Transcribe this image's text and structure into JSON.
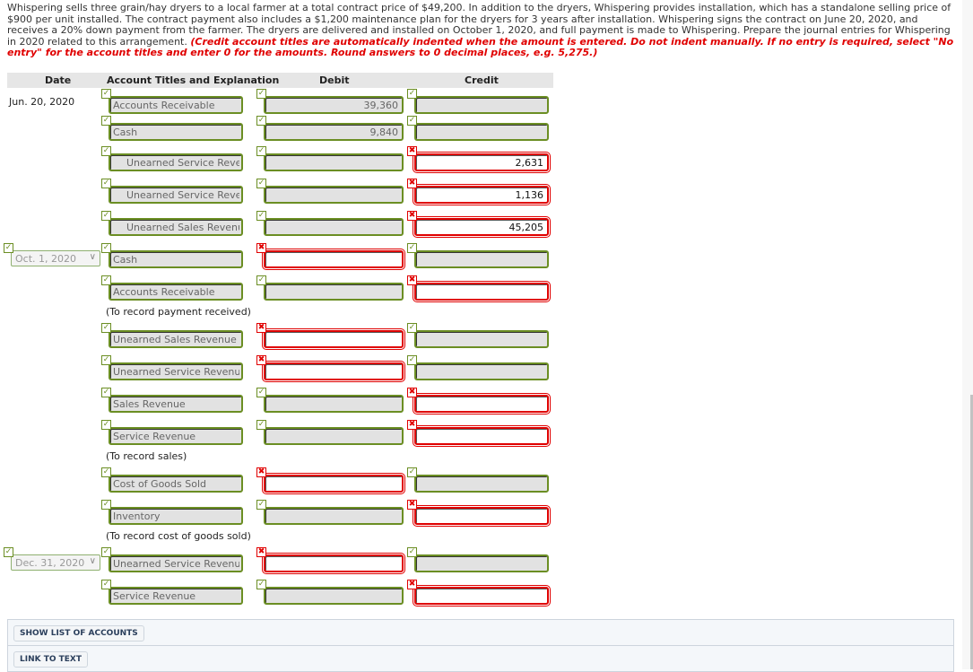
{
  "problem": {
    "text": "Whispering sells three grain/hay dryers to a local farmer at a total contract price of $49,200. In addition to the dryers, Whispering provides installation, which has a standalone selling price of $900 per unit installed. The contract payment also includes a $1,200 maintenance plan for the dryers for 3 years after installation. Whispering signs the contract on June 20, 2020, and receives a 20% down payment from the farmer. The dryers are delivered and installed on October 1, 2020, and full payment is made to Whispering. Prepare the journal entries for Whispering in 2020 related to this arrangement. ",
    "instructions": "(Credit account titles are automatically indented when the amount is entered. Do not indent manually. If no entry is required, select \"No entry\" for the account titles and enter 0 for the amounts. Round answers to 0 decimal places, e.g. 5,275.)"
  },
  "table": {
    "headers": {
      "date": "Date",
      "account": "Account Titles and Explanation",
      "debit": "Debit",
      "credit": "Credit"
    }
  },
  "entries": [
    {
      "date": "Jun. 20, 2020",
      "date_type": "text",
      "rows": [
        {
          "account": "Accounts Receivable",
          "indent": false,
          "account_status": "correct",
          "debit": "39,360",
          "debit_status": "correct",
          "credit": "",
          "credit_status": "correct"
        },
        {
          "account": "Cash",
          "indent": false,
          "account_status": "correct",
          "debit": "9,840",
          "debit_status": "correct",
          "credit": "",
          "credit_status": "correct"
        },
        {
          "account": "Unearned Service Reve",
          "indent": true,
          "account_status": "correct",
          "debit": "",
          "debit_status": "correct",
          "credit": "2,631",
          "credit_status": "incorrect"
        },
        {
          "account": "Unearned Service Reve",
          "indent": true,
          "account_status": "correct",
          "debit": "",
          "debit_status": "correct",
          "credit": "1,136",
          "credit_status": "incorrect"
        },
        {
          "account": "Unearned Sales Revenu",
          "indent": true,
          "account_status": "correct",
          "debit": "",
          "debit_status": "correct",
          "credit": "45,205",
          "credit_status": "incorrect"
        }
      ],
      "explanation": ""
    },
    {
      "date": "Oct. 1, 2020",
      "date_type": "select",
      "date_status": "correct",
      "rows": [
        {
          "account": "Cash",
          "indent": false,
          "account_status": "correct",
          "debit": "",
          "debit_status": "incorrect",
          "credit": "",
          "credit_status": "correct"
        },
        {
          "account": "Accounts Receivable",
          "indent": false,
          "account_status": "correct",
          "debit": "",
          "debit_status": "correct",
          "credit": "",
          "credit_status": "incorrect"
        }
      ],
      "explanation": "(To record payment received)"
    },
    {
      "date": "",
      "date_type": "none",
      "rows": [
        {
          "account": "Unearned Sales Revenue",
          "indent": false,
          "account_status": "correct",
          "debit": "",
          "debit_status": "incorrect",
          "credit": "",
          "credit_status": "correct"
        },
        {
          "account": "Unearned Service Revenue",
          "indent": false,
          "account_status": "correct",
          "debit": "",
          "debit_status": "incorrect",
          "credit": "",
          "credit_status": "correct"
        },
        {
          "account": "Sales Revenue",
          "indent": false,
          "account_status": "correct",
          "debit": "",
          "debit_status": "correct",
          "credit": "",
          "credit_status": "incorrect"
        },
        {
          "account": "Service Revenue",
          "indent": false,
          "account_status": "correct",
          "debit": "",
          "debit_status": "correct",
          "credit": "",
          "credit_status": "incorrect"
        }
      ],
      "explanation": "(To record sales)"
    },
    {
      "date": "",
      "date_type": "none",
      "rows": [
        {
          "account": "Cost of Goods Sold",
          "indent": false,
          "account_status": "correct",
          "debit": "",
          "debit_status": "incorrect",
          "credit": "",
          "credit_status": "correct"
        },
        {
          "account": "Inventory",
          "indent": false,
          "account_status": "correct",
          "debit": "",
          "debit_status": "correct",
          "credit": "",
          "credit_status": "incorrect"
        }
      ],
      "explanation": "(To record cost of goods sold)"
    },
    {
      "date": "Dec. 31, 2020",
      "date_type": "select",
      "date_status": "correct",
      "rows": [
        {
          "account": "Unearned Service Revenue",
          "indent": false,
          "account_status": "correct",
          "debit": "",
          "debit_status": "incorrect",
          "credit": "",
          "credit_status": "correct"
        },
        {
          "account": "Service Revenue",
          "indent": false,
          "account_status": "correct",
          "debit": "",
          "debit_status": "correct",
          "credit": "",
          "credit_status": "incorrect"
        }
      ],
      "explanation": ""
    }
  ],
  "footer": {
    "show_accounts_label": "SHOW LIST OF ACCOUNTS",
    "link_text_label": "LINK TO TEXT"
  },
  "icons": {
    "correct": "check-icon",
    "incorrect": "x-icon"
  },
  "colors": {
    "correct": "#6b8e23",
    "incorrect": "#e00000",
    "instructions": "#e00000"
  }
}
